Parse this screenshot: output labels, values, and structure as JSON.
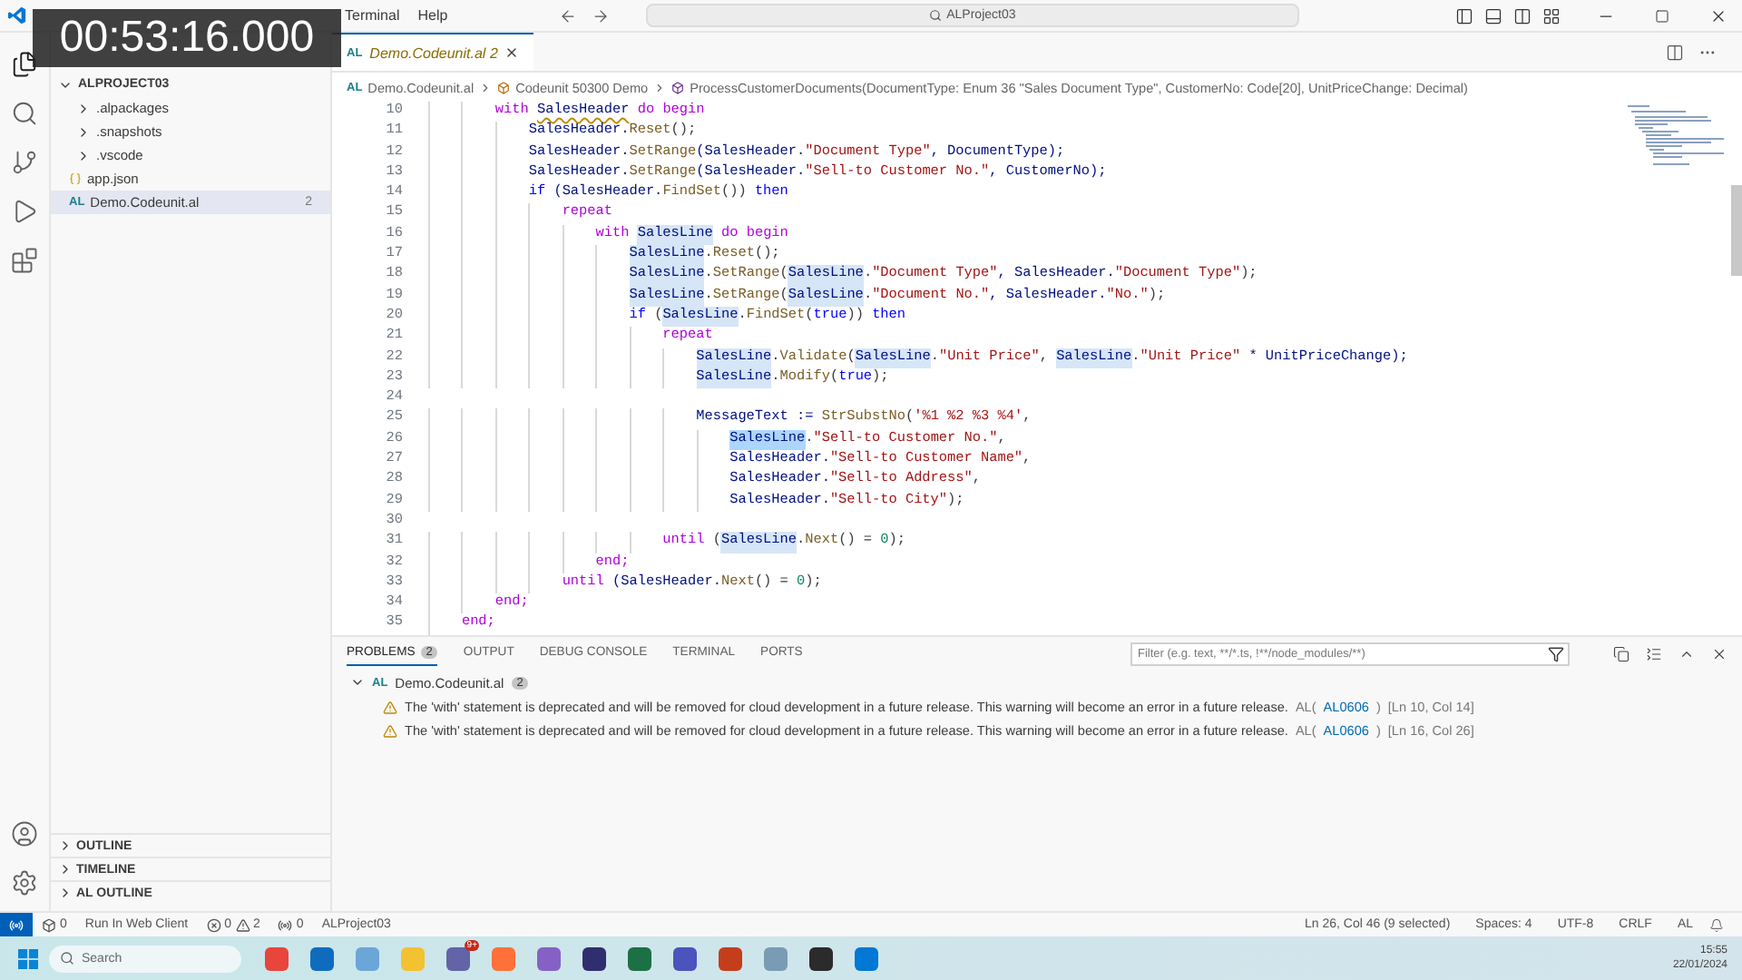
{
  "overlay": {
    "timer": "00:53:16.000"
  },
  "menu": [
    "Terminal",
    "Help"
  ],
  "command_center": {
    "text": "ALProject03"
  },
  "explorer": {
    "project": "ALPROJECT03",
    "expanded": true,
    "items": [
      {
        "kind": "folder",
        "label": ".alpackages",
        "expanded": false,
        "selected": false
      },
      {
        "kind": "folder",
        "label": ".snapshots",
        "expanded": false,
        "selected": false
      },
      {
        "kind": "folder",
        "label": ".vscode",
        "expanded": false,
        "selected": false
      },
      {
        "kind": "json",
        "label": "app.json",
        "selected": false
      },
      {
        "kind": "al",
        "lang": "AL",
        "label": "Demo.Codeunit.al",
        "badge": "2",
        "selected": true
      }
    ],
    "sections": [
      "OUTLINE",
      "TIMELINE",
      "AL OUTLINE"
    ]
  },
  "tabs": [
    {
      "lang": "AL",
      "label": "Demo.Codeunit.al",
      "badge": "2",
      "selected": true
    }
  ],
  "breadcrumbs": [
    {
      "kind": "file",
      "lang": "AL",
      "label": "Demo.Codeunit.al"
    },
    {
      "kind": "codeunit",
      "label": "Codeunit 50300 Demo"
    },
    {
      "kind": "method",
      "label": "ProcessCustomerDocuments(DocumentType: Enum 36 \"Sales Document Type\", CustomerNo: Code[20], UnitPriceChange: Decimal)"
    }
  ],
  "code": [
    {
      "n": "10",
      "tokens": [
        {
          "t": "        with ",
          "kind": "keyword"
        },
        {
          "t": "SalesHeader",
          "kind": "warning"
        },
        {
          "t": " do begin",
          "kind": "keyword"
        }
      ]
    },
    {
      "n": "11",
      "tokens": [
        {
          "t": "            SalesHeader.",
          "kind": "variable"
        },
        {
          "t": "Reset",
          "kind": "function"
        },
        {
          "t": "();",
          "kind": "punctuation"
        }
      ]
    },
    {
      "n": "12",
      "tokens": [
        {
          "t": "            SalesHeader.",
          "kind": "variable"
        },
        {
          "t": "SetRange",
          "kind": "function"
        },
        {
          "t": "(SalesHeader.",
          "kind": "variable"
        },
        {
          "t": "\"Document Type\"",
          "kind": "string"
        },
        {
          "t": ", DocumentType);",
          "kind": "variable"
        }
      ]
    },
    {
      "n": "13",
      "tokens": [
        {
          "t": "            SalesHeader.",
          "kind": "variable"
        },
        {
          "t": "SetRange",
          "kind": "function"
        },
        {
          "t": "(SalesHeader.",
          "kind": "variable"
        },
        {
          "t": "\"Sell-to Customer No.\"",
          "kind": "string"
        },
        {
          "t": ", CustomerNo);",
          "kind": "variable"
        }
      ]
    },
    {
      "n": "14",
      "tokens": [
        {
          "t": "            if ",
          "kind": "control"
        },
        {
          "t": "(SalesHeader.",
          "kind": "variable"
        },
        {
          "t": "FindSet",
          "kind": "function"
        },
        {
          "t": "()) ",
          "kind": "punctuation"
        },
        {
          "t": "then",
          "kind": "control"
        }
      ]
    },
    {
      "n": "15",
      "tokens": [
        {
          "t": "                repeat",
          "kind": "keyword"
        }
      ]
    },
    {
      "n": "16",
      "tokens": [
        {
          "t": "                    with ",
          "kind": "keyword"
        },
        {
          "t": "SalesLine",
          "kind": "highlight"
        },
        {
          "t": " do begin",
          "kind": "keyword"
        }
      ]
    },
    {
      "n": "17",
      "tokens": [
        {
          "t": "                        SalesLine",
          "kind": "highlight"
        },
        {
          "t": ".",
          "kind": "punctuation"
        },
        {
          "t": "Reset",
          "kind": "function"
        },
        {
          "t": "();",
          "kind": "punctuation"
        }
      ]
    },
    {
      "n": "18",
      "tokens": [
        {
          "t": "                        SalesLine",
          "kind": "highlight"
        },
        {
          "t": ".",
          "kind": "punctuation"
        },
        {
          "t": "SetRange",
          "kind": "function"
        },
        {
          "t": "(",
          "kind": "punctuation"
        },
        {
          "t": "SalesLine",
          "kind": "highlight"
        },
        {
          "t": ".",
          "kind": "punctuation"
        },
        {
          "t": "\"Document Type\"",
          "kind": "string"
        },
        {
          "t": ", SalesHeader.",
          "kind": "variable"
        },
        {
          "t": "\"Document Type\"",
          "kind": "string"
        },
        {
          "t": ");",
          "kind": "punctuation"
        }
      ]
    },
    {
      "n": "19",
      "tokens": [
        {
          "t": "                        SalesLine",
          "kind": "highlight"
        },
        {
          "t": ".",
          "kind": "punctuation"
        },
        {
          "t": "SetRange",
          "kind": "function"
        },
        {
          "t": "(",
          "kind": "punctuation"
        },
        {
          "t": "SalesLine",
          "kind": "highlight"
        },
        {
          "t": ".",
          "kind": "punctuation"
        },
        {
          "t": "\"Document No.\"",
          "kind": "string"
        },
        {
          "t": ", SalesHeader.",
          "kind": "variable"
        },
        {
          "t": "\"No.\"",
          "kind": "string"
        },
        {
          "t": ");",
          "kind": "punctuation"
        }
      ]
    },
    {
      "n": "20",
      "tokens": [
        {
          "t": "                        if ",
          "kind": "control"
        },
        {
          "t": "(",
          "kind": "punctuation"
        },
        {
          "t": "SalesLine",
          "kind": "highlight"
        },
        {
          "t": ".",
          "kind": "punctuation"
        },
        {
          "t": "FindSet",
          "kind": "function"
        },
        {
          "t": "(",
          "kind": "punctuation"
        },
        {
          "t": "true",
          "kind": "control"
        },
        {
          "t": ")) ",
          "kind": "punctuation"
        },
        {
          "t": "then",
          "kind": "control"
        }
      ]
    },
    {
      "n": "21",
      "tokens": [
        {
          "t": "                            repeat",
          "kind": "keyword"
        }
      ]
    },
    {
      "n": "22",
      "tokens": [
        {
          "t": "                                SalesLine",
          "kind": "highlight"
        },
        {
          "t": ".",
          "kind": "punctuation"
        },
        {
          "t": "Validate",
          "kind": "function"
        },
        {
          "t": "(",
          "kind": "punctuation"
        },
        {
          "t": "SalesLine",
          "kind": "highlight"
        },
        {
          "t": ".",
          "kind": "punctuation"
        },
        {
          "t": "\"Unit Price\"",
          "kind": "string"
        },
        {
          "t": ", ",
          "kind": "punctuation"
        },
        {
          "t": "SalesLine",
          "kind": "highlight"
        },
        {
          "t": ".",
          "kind": "punctuation"
        },
        {
          "t": "\"Unit Price\"",
          "kind": "string"
        },
        {
          "t": " * UnitPriceChange);",
          "kind": "variable"
        }
      ]
    },
    {
      "n": "23",
      "tokens": [
        {
          "t": "                                SalesLine",
          "kind": "highlight"
        },
        {
          "t": ".",
          "kind": "punctuation"
        },
        {
          "t": "Modify",
          "kind": "function"
        },
        {
          "t": "(",
          "kind": "punctuation"
        },
        {
          "t": "true",
          "kind": "control"
        },
        {
          "t": ");",
          "kind": "punctuation"
        }
      ]
    },
    {
      "n": "24"
    },
    {
      "n": "25",
      "tokens": [
        {
          "t": "                                MessageText := ",
          "kind": "variable"
        },
        {
          "t": "StrSubstNo",
          "kind": "function"
        },
        {
          "t": "(",
          "kind": "punctuation"
        },
        {
          "t": "'%1 %2 %3 %4'",
          "kind": "string"
        },
        {
          "t": ",",
          "kind": "punctuation"
        }
      ]
    },
    {
      "n": "26",
      "tokens": [
        {
          "t": "                                    SalesLine",
          "kind": "selection"
        },
        {
          "t": ".",
          "kind": "punctuation"
        },
        {
          "t": "\"Sell-to Customer No.\"",
          "kind": "string"
        },
        {
          "t": ",",
          "kind": "punctuation"
        }
      ]
    },
    {
      "n": "27",
      "tokens": [
        {
          "t": "                                    SalesHeader.",
          "kind": "variable"
        },
        {
          "t": "\"Sell-to Customer Name\"",
          "kind": "string"
        },
        {
          "t": ",",
          "kind": "punctuation"
        }
      ]
    },
    {
      "n": "28",
      "tokens": [
        {
          "t": "                                    SalesHeader.",
          "kind": "variable"
        },
        {
          "t": "\"Sell-to Address\"",
          "kind": "string"
        },
        {
          "t": ",",
          "kind": "punctuation"
        }
      ]
    },
    {
      "n": "29",
      "tokens": [
        {
          "t": "                                    SalesHeader.",
          "kind": "variable"
        },
        {
          "t": "\"Sell-to City\"",
          "kind": "string"
        },
        {
          "t": ");",
          "kind": "punctuation"
        }
      ]
    },
    {
      "n": "30"
    },
    {
      "n": "31",
      "tokens": [
        {
          "t": "                            until ",
          "kind": "keyword"
        },
        {
          "t": "(",
          "kind": "punctuation"
        },
        {
          "t": "SalesLine",
          "kind": "highlight"
        },
        {
          "t": ".",
          "kind": "punctuation"
        },
        {
          "t": "Next",
          "kind": "function"
        },
        {
          "t": "() = ",
          "kind": "punctuation"
        },
        {
          "t": "0",
          "kind": "number"
        },
        {
          "t": ");",
          "kind": "punctuation"
        }
      ]
    },
    {
      "n": "32",
      "tokens": [
        {
          "t": "                    end;",
          "kind": "keyword"
        }
      ]
    },
    {
      "n": "33",
      "tokens": [
        {
          "t": "                until ",
          "kind": "keyword"
        },
        {
          "t": "(SalesHeader.",
          "kind": "variable"
        },
        {
          "t": "Next",
          "kind": "function"
        },
        {
          "t": "() = ",
          "kind": "punctuation"
        },
        {
          "t": "0",
          "kind": "number"
        },
        {
          "t": ");",
          "kind": "punctuation"
        }
      ]
    },
    {
      "n": "34",
      "tokens": [
        {
          "t": "        end;",
          "kind": "keyword"
        }
      ]
    },
    {
      "n": "35",
      "tokens": [
        {
          "t": "    end;",
          "kind": "keyword"
        }
      ]
    }
  ],
  "panel": {
    "tabs": [
      {
        "label": "PROBLEMS",
        "badge": "2",
        "selected": true
      },
      {
        "label": "OUTPUT",
        "selected": false
      },
      {
        "label": "DEBUG CONSOLE",
        "selected": false
      },
      {
        "label": "TERMINAL",
        "selected": false
      },
      {
        "label": "PORTS",
        "selected": false
      }
    ],
    "filter": {
      "placeholder": "Filter (e.g. text, **/*.ts, !**/node_modules/**)"
    },
    "group": {
      "lang": "AL",
      "file": "Demo.Codeunit.al",
      "count": "2",
      "expanded": true
    },
    "problems": [
      {
        "message": "The 'with' statement is deprecated and will be removed for cloud development in a future release. This warning will become an error in a future release.",
        "source": "AL(",
        "code": "AL0606",
        "source_end": ")",
        "location": "[Ln 10, Col 14]"
      },
      {
        "message": "The 'with' statement is deprecated and will be removed for cloud development in a future release. This warning will become an error in a future release.",
        "source": "AL(",
        "code": "AL0606",
        "source_end": ")",
        "location": "[Ln 16, Col 26]"
      }
    ]
  },
  "status_bar": {
    "left": {
      "deploy_count": "0",
      "run": "Run In Web Client",
      "errors": "0",
      "warnings": "2",
      "ports": "0",
      "project": "ALProject03"
    },
    "right": [
      "Ln 26, Col 46 (9 selected)",
      "Spaces: 4",
      "UTF-8",
      "CRLF",
      "AL"
    ]
  },
  "taskbar": {
    "search_placeholder": "Search",
    "badge": "9+",
    "time": "15:55",
    "date": "22/01/2024"
  }
}
